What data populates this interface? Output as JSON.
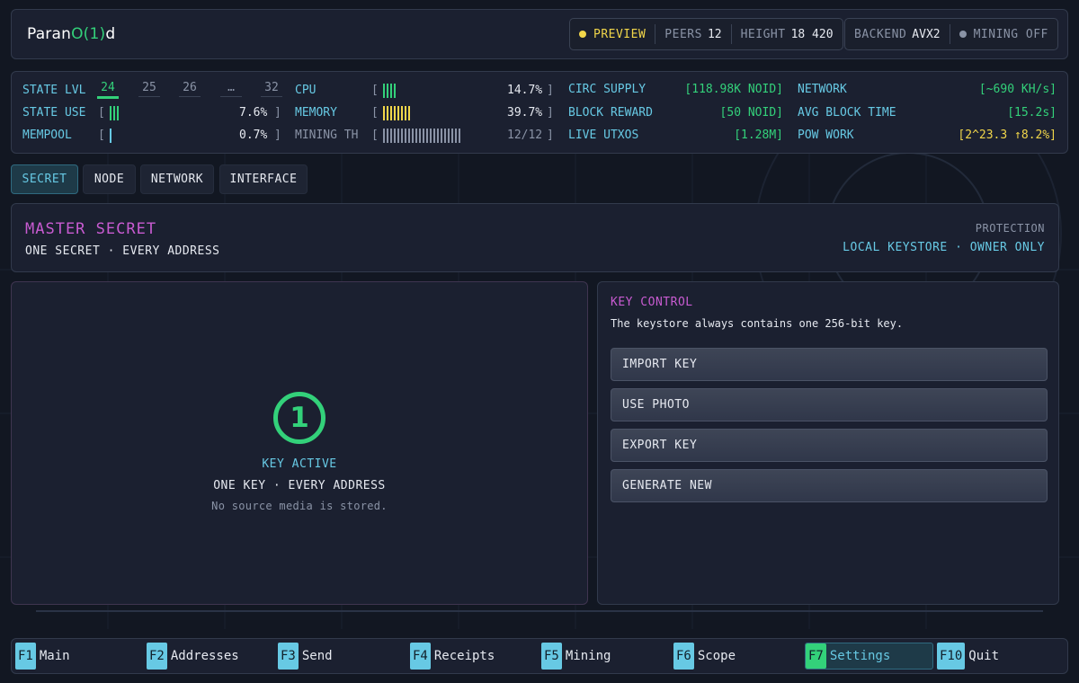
{
  "app": {
    "brand_a": "Paran",
    "brand_b": "O(1)",
    "brand_c": "d"
  },
  "header": {
    "preview": "PREVIEW",
    "peers_label": "PEERS",
    "peers": "12",
    "height_label": "HEIGHT",
    "height": "18 420",
    "backend_label": "BACKEND",
    "backend": "AVX2",
    "mining": "MINING OFF",
    "colors": {
      "preview_dot": "#f1d64a",
      "mining_dot": "#8a93a6"
    }
  },
  "stats": {
    "state_lvl_label": "STATE LVL",
    "levels": [
      "24",
      "25",
      "26",
      "…",
      "32"
    ],
    "active_level": "24",
    "state_use_label": "STATE USE",
    "state_use": "7.6%",
    "mempool_label": "MEMPOOL",
    "mempool": "0.7%",
    "cpu_label": "CPU",
    "cpu": "14.7%",
    "memory_label": "MEMORY",
    "memory": "39.7%",
    "mining_th_label": "MINING TH",
    "mining_th": "12/12",
    "open_bracket": "[",
    "close_bracket": "]",
    "circ_supply_label": "CIRC SUPPLY",
    "circ_supply": "[118.98K NOID]",
    "block_reward_label": "BLOCK REWARD",
    "block_reward": "[50 NOID]",
    "live_utxos_label": "LIVE UTXOS",
    "live_utxos": "[1.28M]",
    "network_label": "NETWORK",
    "network": "[~690 KH/s]",
    "avg_block_label": "AVG BLOCK TIME",
    "avg_block": "[15.2s]",
    "pow_label": "POW WORK",
    "pow": "[2^23.3 ↑8.2%]"
  },
  "tabs": [
    {
      "label": "SECRET",
      "active": true
    },
    {
      "label": "NODE",
      "active": false
    },
    {
      "label": "NETWORK",
      "active": false
    },
    {
      "label": "INTERFACE",
      "active": false
    }
  ],
  "master": {
    "title": "MASTER SECRET",
    "subtitle": "ONE SECRET · EVERY ADDRESS",
    "protection_label": "PROTECTION",
    "protection_value": "LOCAL KEYSTORE · OWNER ONLY"
  },
  "key_status": {
    "icon_glyph": "1",
    "status": "KEY ACTIVE",
    "line": "ONE KEY · EVERY ADDRESS",
    "note": "No source media is stored."
  },
  "key_control": {
    "title": "KEY CONTROL",
    "description": "The keystore always contains one 256-bit key.",
    "buttons": [
      "IMPORT KEY",
      "USE PHOTO",
      "EXPORT KEY",
      "GENERATE NEW"
    ]
  },
  "fkeys": [
    {
      "key": "F1",
      "label": "Main"
    },
    {
      "key": "F2",
      "label": "Addresses"
    },
    {
      "key": "F3",
      "label": "Send"
    },
    {
      "key": "F4",
      "label": "Receipts"
    },
    {
      "key": "F5",
      "label": "Mining"
    },
    {
      "key": "F6",
      "label": "Scope"
    },
    {
      "key": "F7",
      "label": "Settings",
      "active": true
    },
    {
      "key": "F10",
      "label": "Quit"
    }
  ],
  "meters": {
    "state_use_fraction": 0.076,
    "mempool_fraction": 0.007,
    "cpu_fraction": 0.147,
    "memory_fraction": 0.397,
    "mining_threads_active": 12,
    "mining_threads_total": 12
  }
}
